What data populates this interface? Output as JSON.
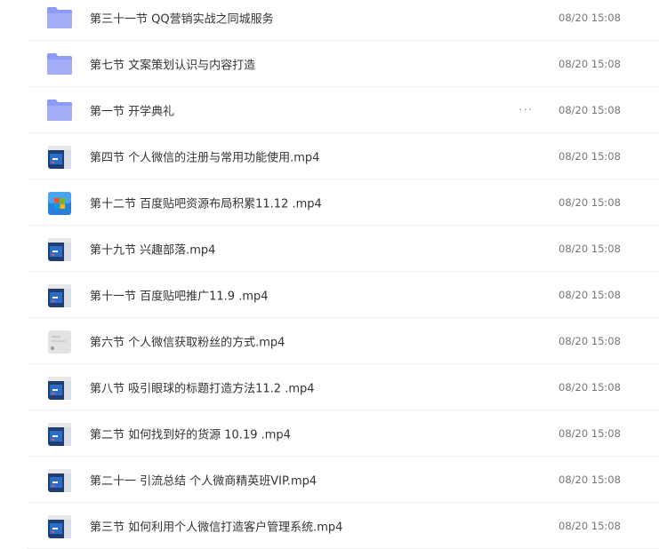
{
  "files": [
    {
      "name": "第三十一节 QQ营销实战之同城服务",
      "date": "08/20 15:08",
      "type": "folder"
    },
    {
      "name": "第七节 文案策划认识与内容打造",
      "date": "08/20 15:08",
      "type": "folder"
    },
    {
      "name": "第一节 开学典礼",
      "date": "08/20 15:08",
      "type": "folder",
      "more": "···"
    },
    {
      "name": "第四节 个人微信的注册与常用功能使用.mp4",
      "date": "08/20 15:08",
      "type": "video"
    },
    {
      "name": "第十二节 百度贴吧资源布局积累11.12 .mp4",
      "date": "08/20 15:08",
      "type": "video-win"
    },
    {
      "name": "第十九节 兴趣部落.mp4",
      "date": "08/20 15:08",
      "type": "video"
    },
    {
      "name": "第十一节 百度贴吧推广11.9 .mp4",
      "date": "08/20 15:08",
      "type": "video"
    },
    {
      "name": "第六节 个人微信获取粉丝的方式.mp4",
      "date": "08/20 15:08",
      "type": "video-gray"
    },
    {
      "name": "第八节 吸引眼球的标题打造方法11.2 .mp4",
      "date": "08/20 15:08",
      "type": "video"
    },
    {
      "name": "第二节 如何找到好的货源 10.19 .mp4",
      "date": "08/20 15:08",
      "type": "video"
    },
    {
      "name": "第二十一 引流总结 个人微商精英班VIP.mp4",
      "date": "08/20 15:08",
      "type": "video"
    },
    {
      "name": "第三节 如何利用个人微信打造客户管理系统.mp4",
      "date": "08/20 15:08",
      "type": "video"
    }
  ],
  "colors": {
    "folder": "#8e9bf5",
    "video_dark": "#1f3f73",
    "video_accent": "#2b6cc4",
    "date": "#777777"
  },
  "icons": {
    "folder": "folder-icon",
    "video": "video-thumbnail-icon",
    "video-win": "video-windows-thumbnail-icon",
    "video-gray": "video-gray-thumbnail-icon",
    "more": "more-icon"
  }
}
